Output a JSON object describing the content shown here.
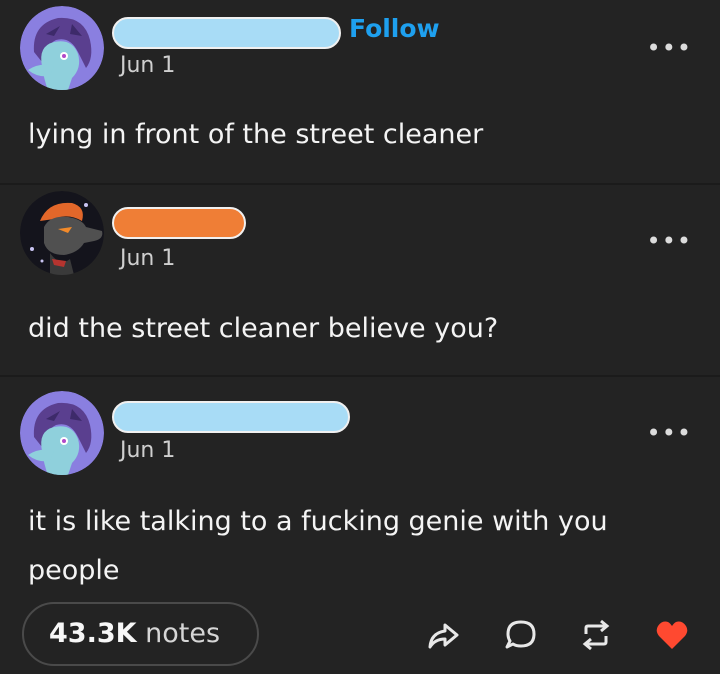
{
  "posts": [
    {
      "date": "Jun 1",
      "text": "lying in front of the street cleaner",
      "follow_label": "Follow",
      "name_color": "#a8dcf6"
    },
    {
      "date": "Jun 1",
      "text": "did the street cleaner believe you?",
      "name_color": "#ef7e36"
    },
    {
      "date": "Jun 1",
      "text": "it is like talking to a fucking genie with you people",
      "name_color": "#a8dcf6"
    }
  ],
  "more_label": "•••",
  "footer": {
    "notes_count": "43.3K",
    "notes_label": "notes",
    "icons": [
      "share-icon",
      "reply-icon",
      "reblog-icon",
      "like-icon"
    ],
    "like_color": "#ff4930"
  }
}
